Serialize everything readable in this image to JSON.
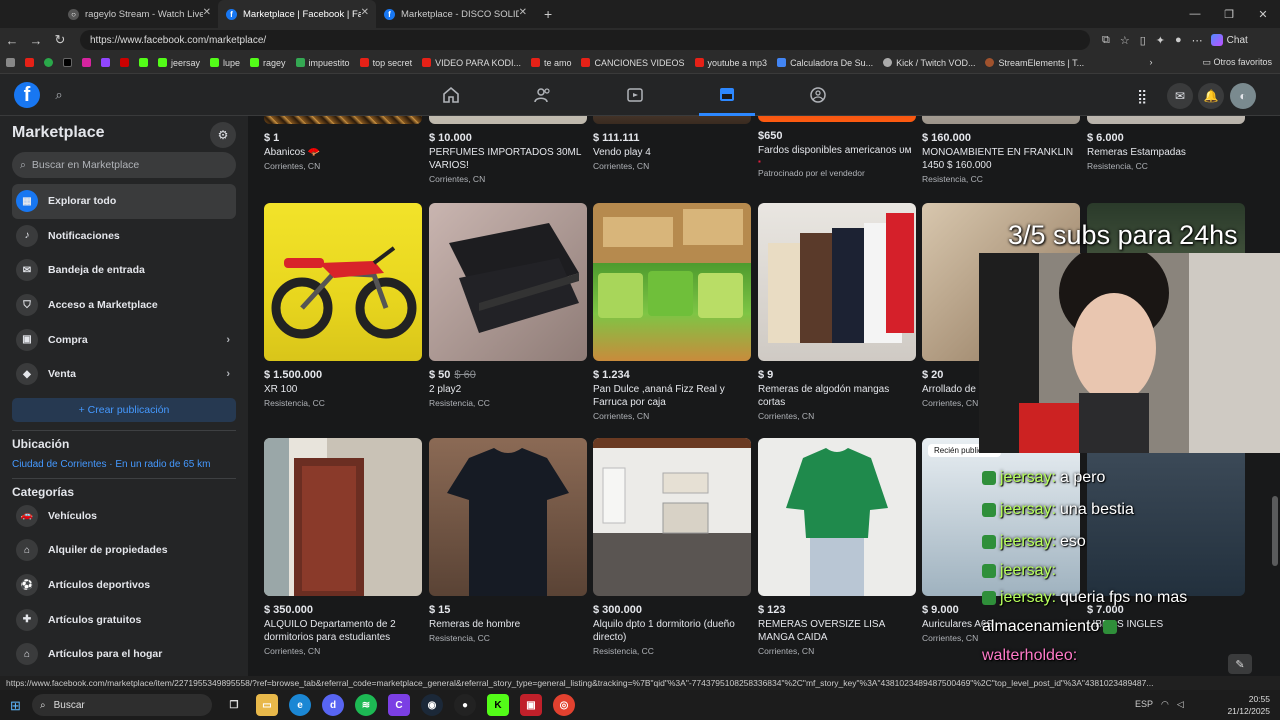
{
  "browser": {
    "tabs": [
      {
        "title": "rageylo Stream - Watch Live o"
      },
      {
        "title": "Marketplace | Facebook | Facebook"
      },
      {
        "title": "Marketplace - DISCO SOLIDO SSD"
      }
    ],
    "url": "https://www.facebook.com/marketplace/",
    "chat_label": "Chat",
    "bookmarks": [
      "jeersay",
      "lupe",
      "ragey",
      "impuestito",
      "top secret",
      "VIDEO PARA KODI...",
      "te amo",
      "CANCIONES VIDEOS",
      "youtube a mp3",
      "Calculadora De Su...",
      "Kick / Twitch VOD...",
      "StreamElements | T..."
    ],
    "other_favorites": "Otros favoritos",
    "status_url": "https://www.facebook.com/marketplace/item/2271955349895558/?ref=browse_tab&referral_code=marketplace_general&referral_story_type=general_listing&tracking=%7B\"qid\"%3A\"-7743795108258336834\"%2C\"mf_story_key\"%3A\"4381023489487500469\"%2C\"top_level_post_id\"%3A\"4381023489487..."
  },
  "sidebar": {
    "title": "Marketplace",
    "search_placeholder": "Buscar en Marketplace",
    "items": [
      {
        "label": "Explorar todo"
      },
      {
        "label": "Notificaciones"
      },
      {
        "label": "Bandeja de entrada"
      },
      {
        "label": "Acceso a Marketplace"
      },
      {
        "label": "Compra"
      },
      {
        "label": "Venta"
      }
    ],
    "create_label": "Crear publicación",
    "location_heading": "Ubicación",
    "location_text": "Ciudad de Corrientes · En un radio de 65 km",
    "categories_heading": "Categorías",
    "categories": [
      {
        "label": "Vehículos"
      },
      {
        "label": "Alquiler de propiedades"
      },
      {
        "label": "Artículos deportivos"
      },
      {
        "label": "Artículos gratuitos"
      },
      {
        "label": "Artículos para el hogar"
      }
    ]
  },
  "listings": {
    "row1": [
      {
        "price": "$ 1",
        "title": "Abanicos 🪭",
        "loc": "Corrientes, CN"
      },
      {
        "price": "$ 10.000",
        "title": "PERFUMES IMPORTADOS 30ML VARIOS!",
        "loc": "Corrientes, CN"
      },
      {
        "price": "$ 111.111",
        "title": "Vendo play 4",
        "loc": "Corrientes, CN"
      },
      {
        "price": "$650",
        "title": "Fardos disponibles americanos ᴜᴍ",
        "loc": "Patrocinado por el vendedor"
      },
      {
        "price": "$ 160.000",
        "title": "MONOAMBIENTE EN FRANKLIN 1450 $ 160.000",
        "loc": "Resistencia, CC"
      },
      {
        "price": "$ 6.000",
        "title": "Remeras Estampadas",
        "loc": "Resistencia, CC"
      }
    ],
    "row2": [
      {
        "price": "$ 1.500.000",
        "title": "XR 100",
        "loc": "Resistencia, CC"
      },
      {
        "price": "$ 50",
        "old_price": "$ 60",
        "title": "2 play2",
        "loc": "Resistencia, CC"
      },
      {
        "price": "$ 1.234",
        "title": "Pan Dulce ,ananá Fizz Real y Farruca por caja",
        "loc": "Corrientes, CN"
      },
      {
        "price": "$ 9",
        "title": "Remeras de algodón mangas cortas",
        "loc": "Corrientes, CN"
      },
      {
        "price": "$ 20",
        "title": "Arrollado de",
        "loc": "Corrientes, CN"
      }
    ],
    "row3": [
      {
        "price": "$ 350.000",
        "title": "ALQUILO Departamento de 2 dormitorios para estudiantes",
        "loc": "Corrientes, CN"
      },
      {
        "price": "$ 15",
        "title": "Remeras de hombre",
        "loc": "Resistencia, CC"
      },
      {
        "price": "$ 300.000",
        "title": "Alquilo dpto 1 dormitorio (dueño directo)",
        "loc": "Resistencia, CC"
      },
      {
        "price": "$ 123",
        "title": "REMERAS OVERSIZE LISA MANGA CAIDA",
        "loc": "Corrientes, CN"
      },
      {
        "price": "$ 9.000",
        "title": "Auriculares A6S",
        "loc": "Corrientes, CN",
        "badge": "Recién publicado"
      },
      {
        "price": "$ 7.000",
        "title": "LIBROS INGLES",
        "loc": ""
      }
    ]
  },
  "stream": {
    "subs_text": "3/5 subs para 24hs",
    "chat": [
      {
        "user": "jeersay:",
        "msg": "a pero"
      },
      {
        "user": "jeersay:",
        "msg": "una bestia"
      },
      {
        "user": "jeersay:",
        "msg": "eso"
      },
      {
        "user": "jeersay:",
        "msg": ""
      },
      {
        "user": "jeersay:",
        "msg": "queria fps no mas"
      },
      {
        "user": "",
        "msg": "almacenamiento"
      },
      {
        "user": "walterholdeo:",
        "msg": ""
      }
    ]
  },
  "taskbar": {
    "search_label": "Buscar",
    "lang": "ESP",
    "time": "20:55",
    "date": "21/12/2025"
  },
  "colors": {
    "accent": "#1877f2",
    "link": "#4599ff",
    "bg": "#18191a",
    "panel": "#242526"
  }
}
